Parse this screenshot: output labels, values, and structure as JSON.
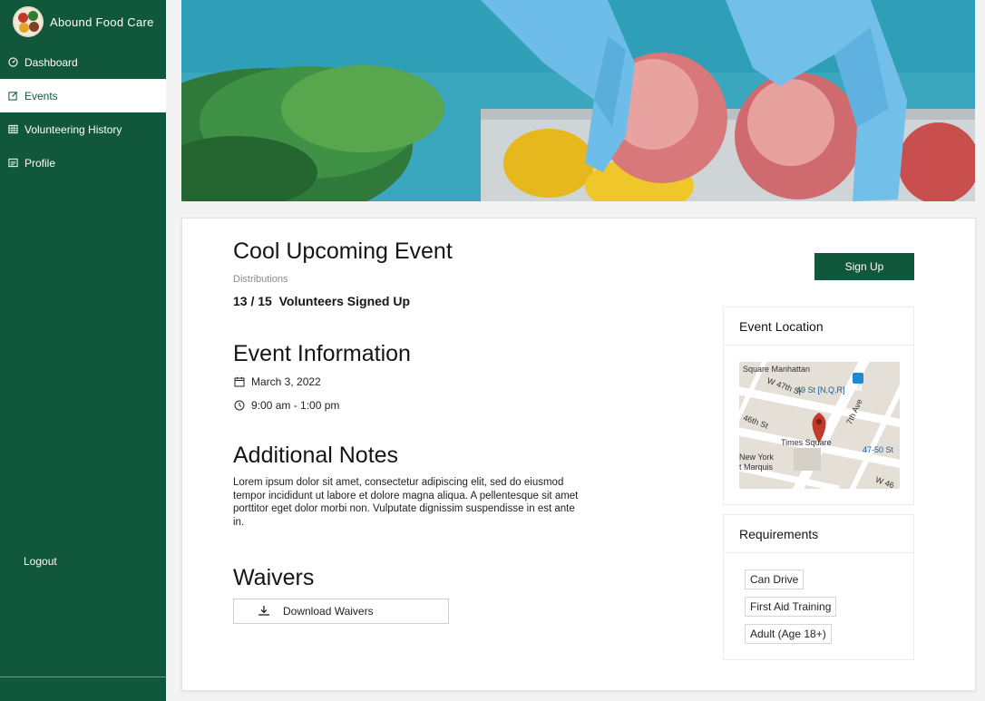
{
  "sidebar": {
    "brand": "Abound Food Care",
    "items": [
      {
        "label": "Dashboard",
        "icon": "dashboard-icon",
        "active": false
      },
      {
        "label": "Events",
        "icon": "edit-icon",
        "active": true
      },
      {
        "label": "Volunteering History",
        "icon": "table-icon",
        "active": false
      },
      {
        "label": "Profile",
        "icon": "profile-icon",
        "active": false
      }
    ],
    "logout": "Logout"
  },
  "event": {
    "title": "Cool Upcoming Event",
    "category": "Distributions",
    "signed_up": "13 / 15",
    "signed_up_suffix": "Volunteers Signed Up",
    "signup_label": "Sign Up"
  },
  "info": {
    "heading": "Event Information",
    "date": "March 3, 2022",
    "time": "9:00 am - 1:00 pm"
  },
  "notes": {
    "heading": "Additional Notes",
    "body": "Lorem ipsum dolor sit amet, consectetur adipiscing elit, sed do eiusmod tempor incididunt ut labore et dolore magna aliqua. A pellentesque sit amet porttitor eget dolor morbi non. Vulputate dignissim suspendisse in est ante in."
  },
  "waivers": {
    "heading": "Waivers",
    "download_label": "Download Waivers"
  },
  "location": {
    "heading": "Event Location",
    "map_labels": [
      "Square Manhattan",
      "W 47th St",
      "49 St [N,Q,R]",
      "M",
      "46th St",
      "7th Ave",
      "Times Square",
      "47-50 St",
      "New York",
      "t Marquis",
      "W 46"
    ]
  },
  "requirements": {
    "heading": "Requirements",
    "items": [
      "Can Drive",
      "First Aid Training",
      "Adult (Age 18+)"
    ]
  },
  "colors": {
    "primary": "#10573b",
    "sidebar_text": "#ffffff",
    "muted": "#8a8a8a"
  }
}
